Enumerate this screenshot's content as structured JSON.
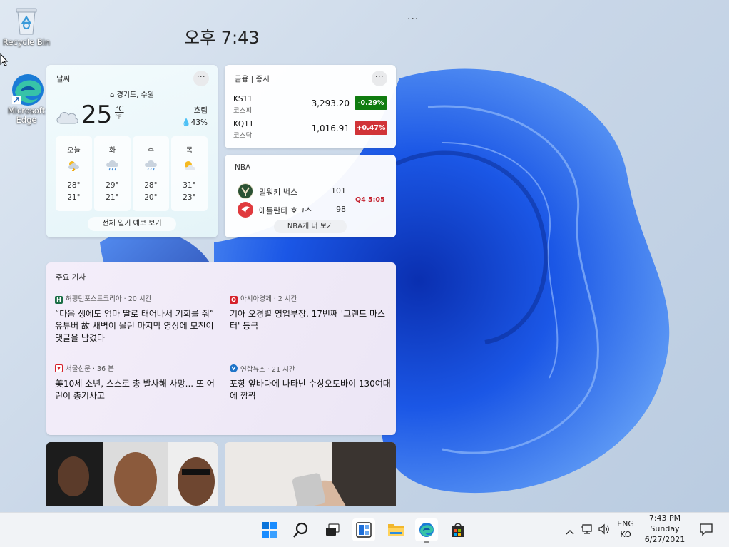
{
  "desktop": {
    "icons": [
      {
        "label": "Recycle Bin",
        "icon": "recycle-bin-icon"
      },
      {
        "label": "Microsoft Edge",
        "icon": "edge-icon"
      }
    ]
  },
  "widgets": {
    "clock": "오후 7:43",
    "more": "···",
    "weather": {
      "title": "날씨",
      "location": "경기도, 수원",
      "temp": "25",
      "unit_c": "°C",
      "unit_f": "°F",
      "condition": "흐림",
      "humidity": "43%",
      "days": [
        {
          "name": "오늘",
          "icon": "thunder-sun-icon",
          "high": "28°",
          "low": "21°"
        },
        {
          "name": "화",
          "icon": "rain-icon",
          "high": "29°",
          "low": "21°"
        },
        {
          "name": "수",
          "icon": "rain-icon",
          "high": "28°",
          "low": "20°"
        },
        {
          "name": "목",
          "icon": "partly-cloudy-icon",
          "high": "31°",
          "low": "23°"
        }
      ],
      "forecast_button": "전체 일기 예보 보기"
    },
    "finance": {
      "title": "금융 | 증시",
      "stocks": [
        {
          "symbol": "KS11",
          "name": "코스피",
          "value": "3,293.20",
          "change": "-0.29%",
          "color": "#107c10"
        },
        {
          "symbol": "KQ11",
          "name": "코스닥",
          "value": "1,016.91",
          "change": "+0.47%",
          "color": "#d13438"
        }
      ]
    },
    "nba": {
      "title": "NBA",
      "teams": [
        {
          "name": "밀워키 벅스",
          "score": "101",
          "color": "#2c5234"
        },
        {
          "name": "애틀란타 호크스",
          "score": "98",
          "color": "#e03a3e"
        }
      ],
      "status": "Q4 5:05",
      "more_button": "NBA개 더 보기"
    },
    "news": {
      "title": "주요 기사",
      "articles": [
        {
          "source": "허핑턴포스트코리아 · 20 시간",
          "badge": "H",
          "badge_color": "#1a6e45",
          "headline": "“다음 생에도 엄마 딸로 태어나서 기회를 줘” 유튜버 故 새벽이 올린 마지막 영상에 모친이 댓글을 남겼다"
        },
        {
          "source": "아시아경제 · 2 시간",
          "badge": "Q",
          "badge_color": "#d6202a",
          "headline": "기아 오경렬 영업부장, 17번째 '그랜드 마스터' 등극"
        },
        {
          "source": "서울신문 · 36 분",
          "badge": "",
          "badge_color": "#d6202a",
          "headline": "美10세 소년, 스스로 총 발사해 사망... 또 어린이 총기사고"
        },
        {
          "source": "연합뉴스 · 21 시간",
          "badge": "",
          "badge_color": "#1e74c8",
          "headline": "포항 앞바다에 나타난 수상오토바이 130여대에 깜짝"
        }
      ]
    }
  },
  "taskbar": {
    "apps": [
      {
        "name": "start-button",
        "icon": "windows-icon"
      },
      {
        "name": "search-button",
        "icon": "search-icon"
      },
      {
        "name": "task-view-button",
        "icon": "task-view-icon"
      },
      {
        "name": "widgets-button",
        "icon": "widgets-icon"
      },
      {
        "name": "file-explorer-button",
        "icon": "folder-icon"
      },
      {
        "name": "edge-button",
        "icon": "edge-icon"
      },
      {
        "name": "store-button",
        "icon": "store-icon"
      }
    ],
    "tray": {
      "lang_top": "ENG",
      "lang_bottom": "KO",
      "time": "7:43 PM",
      "day": "Sunday",
      "date": "6/27/2021"
    }
  }
}
